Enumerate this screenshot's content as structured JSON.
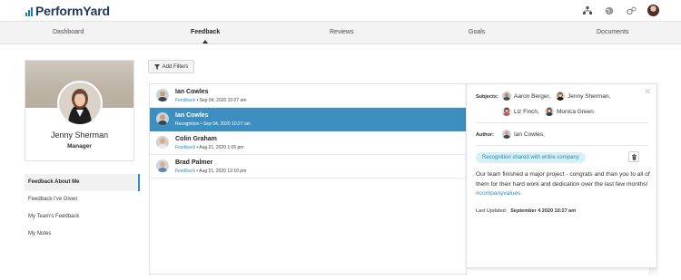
{
  "header": {
    "logo_text": "PerformYard",
    "icons": [
      "org-chart-icon",
      "globe-icon",
      "settings-gears-icon",
      "user-avatar"
    ],
    "brand_color": "#1a7ba8"
  },
  "nav": {
    "tabs": [
      {
        "label": "Dashboard",
        "active": false
      },
      {
        "label": "Feedback",
        "active": true
      },
      {
        "label": "Reviews",
        "active": false
      },
      {
        "label": "Goals",
        "active": false
      },
      {
        "label": "Documents",
        "active": false
      }
    ]
  },
  "profile": {
    "name": "Jenny Sherman",
    "role": "Manager"
  },
  "sidebar": {
    "items": [
      {
        "label": "Feedback About Me",
        "active": true
      },
      {
        "label": "Feedback I've Given",
        "active": false
      },
      {
        "label": "My Team's Feedback",
        "active": false
      },
      {
        "label": "My Notes",
        "active": false
      }
    ]
  },
  "filters": {
    "add_label": "Add Filters"
  },
  "feedback_list": [
    {
      "name": "Ian Cowles",
      "type": "Feedback",
      "sep": "•",
      "date": "Sep 04, 2020 10:27 am",
      "selected": false
    },
    {
      "name": "Ian Cowles",
      "type": "Recognition",
      "sep": "•",
      "date": "Sep 04, 2020 10:27 am",
      "selected": true
    },
    {
      "name": "Colin Graham",
      "type": "Feedback",
      "sep": "•",
      "date": "Aug 21, 2020 1:05 pm",
      "selected": false
    },
    {
      "name": "Brad Palmer",
      "type": "Feedback",
      "sep": "•",
      "date": "Aug 21, 2020 12:10 pm",
      "selected": false
    }
  ],
  "detail": {
    "subjects_label": "Subjects:",
    "subjects": [
      "Aaron Berger,",
      "Jenny Sherman,",
      "Liz Finch,",
      "Monica Green"
    ],
    "author_label": "Author:",
    "author": "Ian Cowles,",
    "tag": "Recognition shared with entire company",
    "message": "Our team finished a major project - congrats and than you to all of them for their hard work and dedication over the last few months!",
    "hashtag": "#companyvalues",
    "updated_label": "Last Updated:",
    "updated_value": "September 4 2020 10:27 am",
    "accent_color": "#3d8ec1"
  }
}
